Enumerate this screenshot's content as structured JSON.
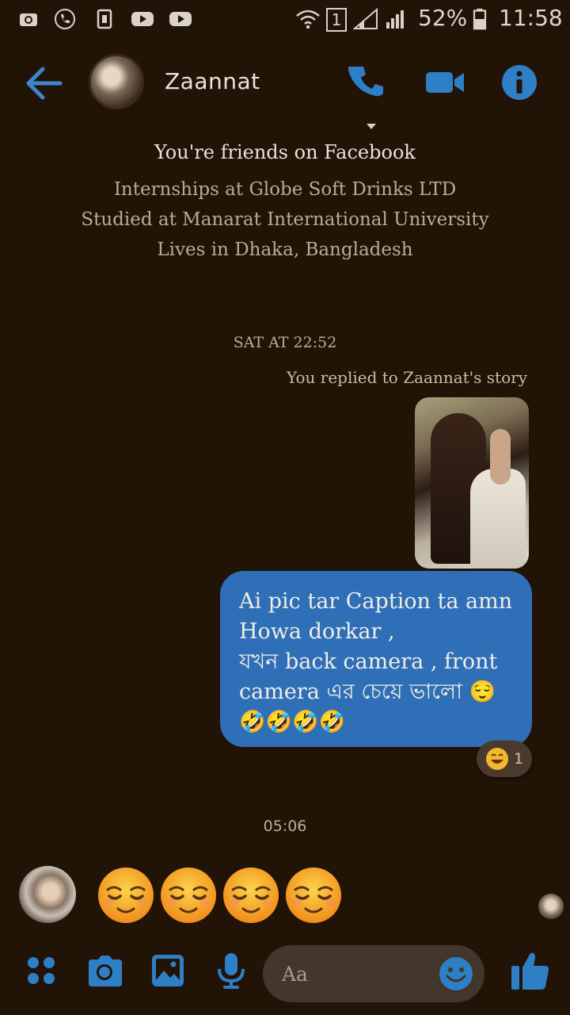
{
  "status_bar": {
    "battery": "52%",
    "time": "11:58",
    "sim": "1"
  },
  "header": {
    "contact_name": "Zaannat",
    "icons": [
      "back-arrow-icon",
      "phone-icon",
      "video-camera-icon",
      "info-icon"
    ]
  },
  "profile_info": {
    "friends_text": "You're friends on Facebook",
    "lines": [
      "Internships at Globe Soft Drinks LTD",
      "Studied at Manarat International University",
      "Lives in Dhaka, Bangladesh"
    ]
  },
  "conversation": {
    "timestamp_1": "SAT AT 22:52",
    "replied_label": "You replied to Zaannat's story",
    "message_lines": [
      "Ai pic tar Caption ta amn",
      "Howa dorkar ,",
      "যখন back camera , front",
      "camera এর চেয়ে ভালো 😌",
      "🤣🤣🤣🤣"
    ],
    "reaction_emoji": "😄",
    "reaction_count": "1",
    "timestamp_2": "05:06",
    "incoming_emojis": 4
  },
  "composer": {
    "placeholder": "Aa",
    "icons": [
      "apps-icon",
      "camera-icon",
      "gallery-icon",
      "microphone-icon",
      "emoji-icon",
      "thumbs-up-icon"
    ]
  },
  "colors": {
    "background": "#221307",
    "accent": "#2d7fc6",
    "bubble": "#2e6fb7"
  }
}
